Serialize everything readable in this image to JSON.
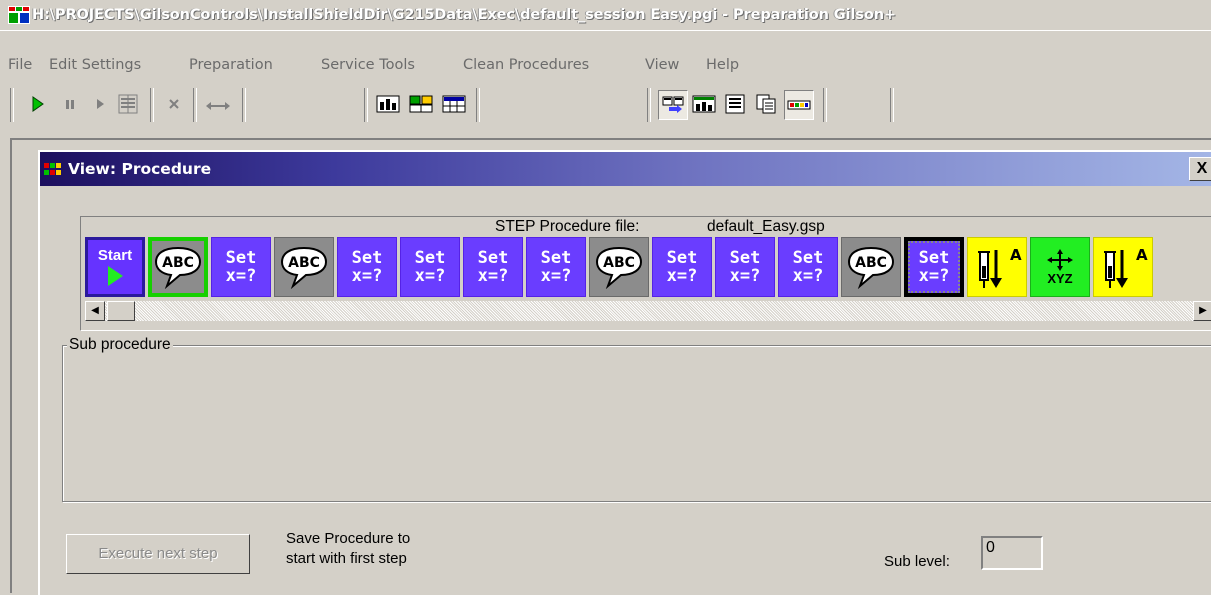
{
  "window": {
    "title": "H:\\PROJECTS\\GilsonControls\\InstallShieldDir\\G215Data\\Exec\\default_session  Easy.pgi - Preparation Gilson+"
  },
  "menu": [
    {
      "label": "File"
    },
    {
      "label": "Edit Settings"
    },
    {
      "label": "Preparation"
    },
    {
      "label": "Service Tools"
    },
    {
      "label": "Clean Procedures"
    },
    {
      "label": "View"
    },
    {
      "label": "Help"
    }
  ],
  "toolbar": {
    "buttons": [
      {
        "icon": "play-icon"
      },
      {
        "icon": "pause-icon"
      },
      {
        "icon": "step-icon"
      },
      {
        "icon": "step-list-icon"
      },
      {
        "icon": "stop-icon"
      },
      {
        "icon": "swap-icon"
      },
      {
        "icon": "view-tool-1-icon"
      },
      {
        "icon": "view-tool-2-icon"
      },
      {
        "icon": "view-tool-3-icon"
      },
      {
        "icon": "procedure-view-icon"
      },
      {
        "icon": "chart-view-icon"
      },
      {
        "icon": "list-view-icon"
      },
      {
        "icon": "copy-view-icon"
      },
      {
        "icon": "color-view-icon"
      }
    ]
  },
  "procedure_window": {
    "title": "View: Procedure",
    "close_label": "X",
    "step_file_label": "STEP Procedure file:",
    "step_file_name": "default_Easy.gsp",
    "steps": [
      {
        "type": "start",
        "label": "Start"
      },
      {
        "type": "abc",
        "label": "ABC",
        "active": true
      },
      {
        "type": "set",
        "line1": "Set",
        "line2": "x=?"
      },
      {
        "type": "abc",
        "label": "ABC"
      },
      {
        "type": "set",
        "line1": "Set",
        "line2": "x=?"
      },
      {
        "type": "set",
        "line1": "Set",
        "line2": "x=?"
      },
      {
        "type": "set",
        "line1": "Set",
        "line2": "x=?"
      },
      {
        "type": "set",
        "line1": "Set",
        "line2": "x=?"
      },
      {
        "type": "abc",
        "label": "ABC"
      },
      {
        "type": "set",
        "line1": "Set",
        "line2": "x=?"
      },
      {
        "type": "set",
        "line1": "Set",
        "line2": "x=?"
      },
      {
        "type": "set",
        "line1": "Set",
        "line2": "x=?"
      },
      {
        "type": "abc",
        "label": "ABC"
      },
      {
        "type": "set",
        "line1": "Set",
        "line2": "x=?",
        "selected": true
      },
      {
        "type": "yellow",
        "label": "A"
      },
      {
        "type": "green",
        "label": "XYZ"
      },
      {
        "type": "yellow",
        "label": "A"
      }
    ],
    "sub_procedure_label": "Sub procedure",
    "execute_button": "Execute next step",
    "save_text_line1": "Save Procedure to",
    "save_text_line2": "start with first step",
    "sub_level_label": "Sub level:",
    "sub_level_value": "0"
  },
  "colors": {
    "set_step": "#6a3dff",
    "abc_step": "#8c8c8c",
    "active_border": "#16d000",
    "yellow_step": "#ffff00",
    "green_step": "#22ee22"
  }
}
